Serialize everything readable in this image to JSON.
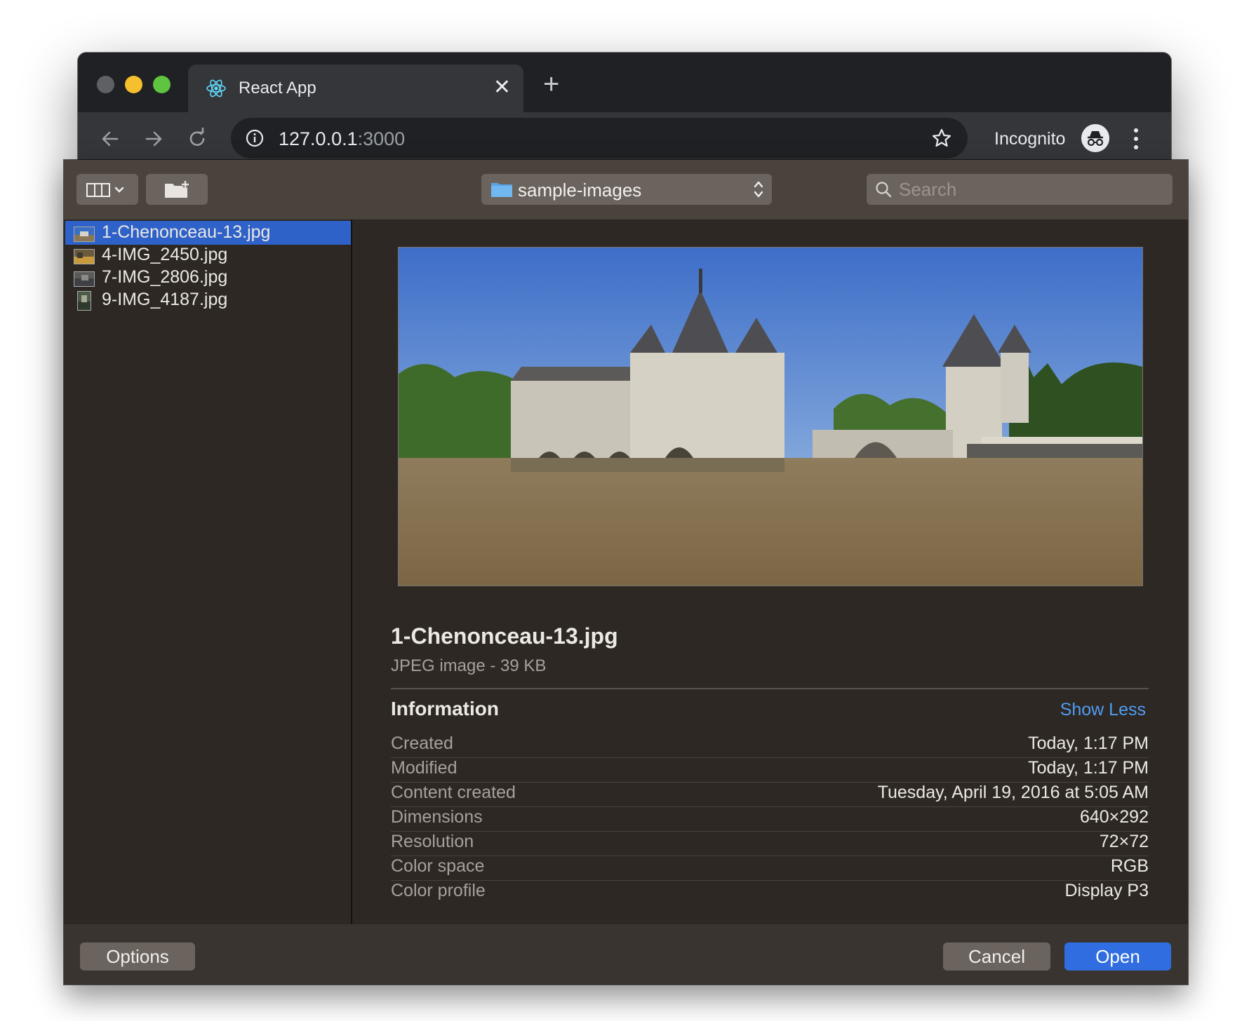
{
  "browser": {
    "tab_title": "React App",
    "url_host": "127.0.0.1",
    "url_port": ":3000",
    "incognito_label": "Incognito"
  },
  "dialog": {
    "location": "sample-images",
    "search_placeholder": "Search",
    "files": [
      {
        "name": "1-Chenonceau-13.jpg",
        "selected": true
      },
      {
        "name": "4-IMG_2450.jpg",
        "selected": false
      },
      {
        "name": "7-IMG_2806.jpg",
        "selected": false
      },
      {
        "name": "9-IMG_4187.jpg",
        "selected": false
      }
    ],
    "preview": {
      "filename": "1-Chenonceau-13.jpg",
      "kind": "JPEG image - 39 KB",
      "info_heading": "Information",
      "show_less": "Show Less",
      "info": [
        {
          "key": "Created",
          "value": "Today, 1:17 PM"
        },
        {
          "key": "Modified",
          "value": "Today, 1:17 PM"
        },
        {
          "key": "Content created",
          "value": "Tuesday, April 19, 2016 at 5:05 AM"
        },
        {
          "key": "Dimensions",
          "value": "640×292"
        },
        {
          "key": "Resolution",
          "value": "72×72"
        },
        {
          "key": "Color space",
          "value": "RGB"
        },
        {
          "key": "Color profile",
          "value": "Display P3"
        }
      ]
    },
    "buttons": {
      "options": "Options",
      "cancel": "Cancel",
      "open": "Open"
    }
  },
  "colors": {
    "selection": "#2f62c9",
    "primary_button": "#2f6de0",
    "link": "#4f9cf2"
  }
}
